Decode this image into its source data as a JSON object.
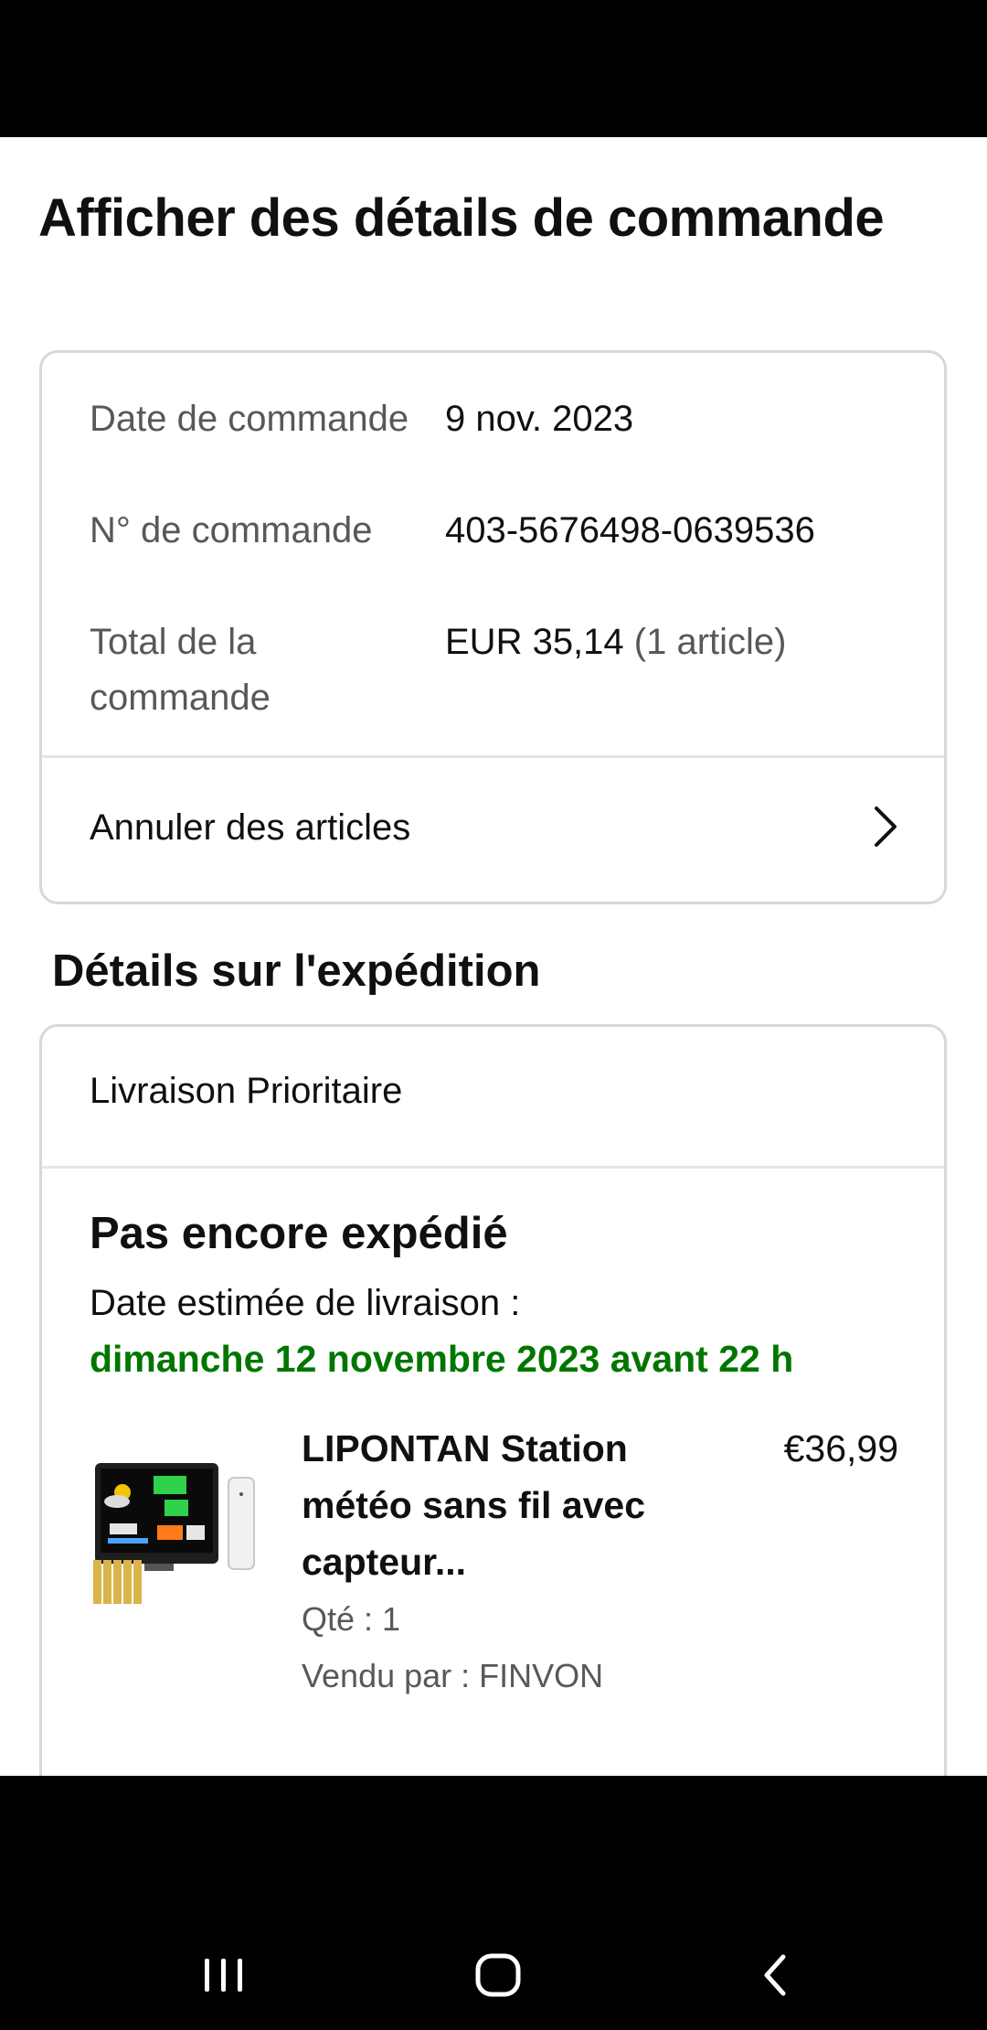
{
  "page": {
    "title": "Afficher des détails de commande"
  },
  "order_summary": {
    "rows": [
      {
        "label": "Date de commande",
        "value": "9 nov. 2023",
        "value_suffix": ""
      },
      {
        "label": "N° de commande",
        "value": "403-5676498-0639536",
        "value_suffix": ""
      },
      {
        "label": "Total de la commande",
        "value": "EUR 35,14",
        "value_suffix": "(1 article)"
      }
    ],
    "cancel_label": "Annuler des articles"
  },
  "shipping": {
    "section_title": "Détails sur l'expédition",
    "method": "Livraison Prioritaire",
    "status": "Pas encore expédié",
    "eta_label": "Date estimée de livraison :",
    "eta_date": "dimanche 12 novembre 2023 avant 22 h",
    "eta_color": "#007600"
  },
  "product": {
    "title": "LIPONTAN Station météo sans fil avec capteur...",
    "price": "€36,99",
    "qty": "Qté : 1",
    "seller": "Vendu par : FINVON",
    "image_icon": "weather-station-image"
  },
  "system_nav": {
    "icons": [
      "recent-apps-icon",
      "home-icon",
      "back-icon"
    ]
  }
}
